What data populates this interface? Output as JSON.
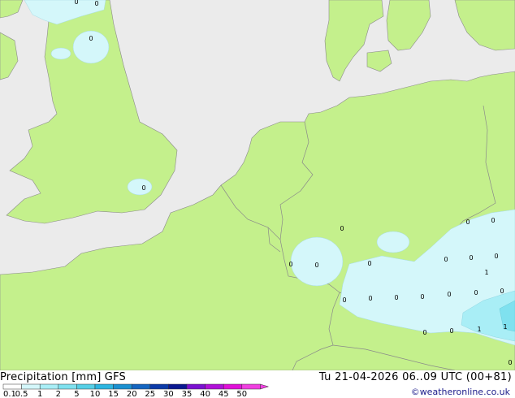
{
  "header": {
    "title": "Precipitation [mm]  GFS",
    "valid_time": "Tu 21-04-2026 06..09 UTC (00+81)",
    "credit": "©weatheronline.co.uk"
  },
  "colors": {
    "sea": "#ebebeb",
    "land": "#c4f08c",
    "border": "#9a9a9a",
    "precip_light": "#d4f7fa",
    "precip_medium": "#a9eef6",
    "precip_heavy": "#7fe1ef"
  },
  "legend": {
    "levels": [
      "0.1",
      "0.5",
      "1",
      "2",
      "5",
      "10",
      "15",
      "20",
      "25",
      "30",
      "35",
      "40",
      "45",
      "50"
    ],
    "colors": [
      "#ffffff",
      "#d4f7fa",
      "#a9eef6",
      "#7fe1ef",
      "#56cfe6",
      "#2db5e0",
      "#1a90d0",
      "#1465c0",
      "#0b3aa8",
      "#0a1890",
      "#7a10d0",
      "#b010d8",
      "#e010d8",
      "#f040e0"
    ]
  },
  "map": {
    "labels": [
      "0",
      "0",
      "0",
      "0",
      "0",
      "0",
      "0",
      "0",
      "0",
      "0",
      "0",
      "0",
      "0",
      "0",
      "0",
      "0",
      "0",
      "0",
      "0",
      "0",
      "0",
      "0",
      "1",
      "1",
      "1",
      "0"
    ]
  }
}
